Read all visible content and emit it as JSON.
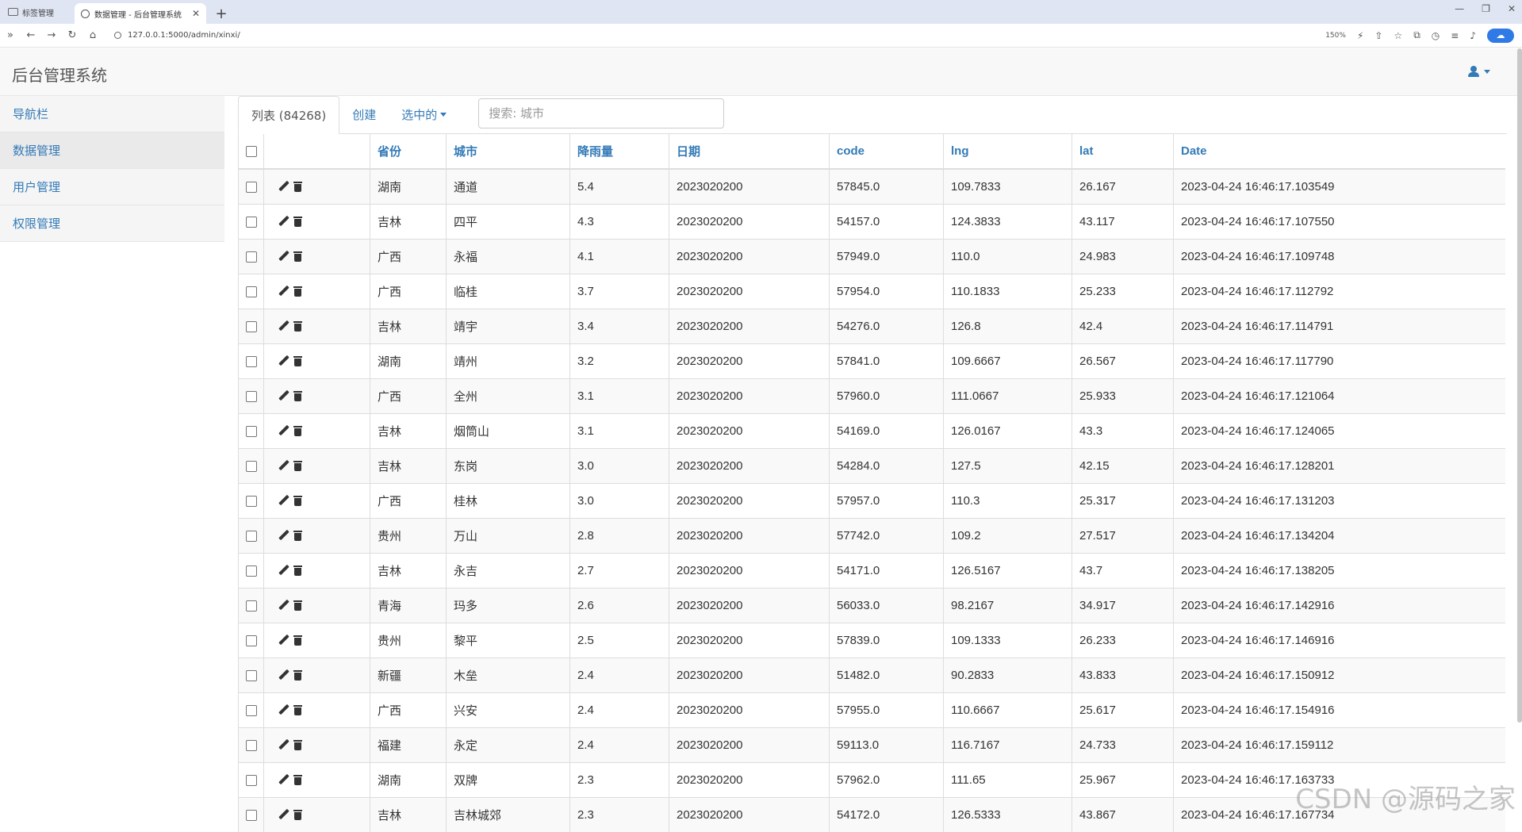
{
  "browser": {
    "tab_group_label": "标签管理",
    "tab_title": "数据管理 - 后台管理系统",
    "tab_close": "✕",
    "new_tab": "+",
    "url": "127.0.0.1:5000/admin/xinxi/",
    "zoom": "150%",
    "win_min": "—",
    "win_max": "❐",
    "win_close": "✕"
  },
  "app": {
    "brand": "后台管理系统",
    "sidebar": [
      {
        "label": "导航栏"
      },
      {
        "label": "数据管理"
      },
      {
        "label": "用户管理"
      },
      {
        "label": "权限管理"
      }
    ],
    "tabs": {
      "list": "列表 (84268)",
      "create": "创建",
      "selected": "选中的"
    },
    "search": {
      "placeholder": "搜索: 城市",
      "value": ""
    },
    "columns": [
      "省份",
      "城市",
      "降雨量",
      "日期",
      "code",
      "lng",
      "lat",
      "Date"
    ],
    "rows": [
      [
        "湖南",
        "通道",
        "5.4",
        "2023020200",
        "57845.0",
        "109.7833",
        "26.167",
        "2023-04-24 16:46:17.103549"
      ],
      [
        "吉林",
        "四平",
        "4.3",
        "2023020200",
        "54157.0",
        "124.3833",
        "43.117",
        "2023-04-24 16:46:17.107550"
      ],
      [
        "广西",
        "永福",
        "4.1",
        "2023020200",
        "57949.0",
        "110.0",
        "24.983",
        "2023-04-24 16:46:17.109748"
      ],
      [
        "广西",
        "临桂",
        "3.7",
        "2023020200",
        "57954.0",
        "110.1833",
        "25.233",
        "2023-04-24 16:46:17.112792"
      ],
      [
        "吉林",
        "靖宇",
        "3.4",
        "2023020200",
        "54276.0",
        "126.8",
        "42.4",
        "2023-04-24 16:46:17.114791"
      ],
      [
        "湖南",
        "靖州",
        "3.2",
        "2023020200",
        "57841.0",
        "109.6667",
        "26.567",
        "2023-04-24 16:46:17.117790"
      ],
      [
        "广西",
        "全州",
        "3.1",
        "2023020200",
        "57960.0",
        "111.0667",
        "25.933",
        "2023-04-24 16:46:17.121064"
      ],
      [
        "吉林",
        "烟筒山",
        "3.1",
        "2023020200",
        "54169.0",
        "126.0167",
        "43.3",
        "2023-04-24 16:46:17.124065"
      ],
      [
        "吉林",
        "东岗",
        "3.0",
        "2023020200",
        "54284.0",
        "127.5",
        "42.15",
        "2023-04-24 16:46:17.128201"
      ],
      [
        "广西",
        "桂林",
        "3.0",
        "2023020200",
        "57957.0",
        "110.3",
        "25.317",
        "2023-04-24 16:46:17.131203"
      ],
      [
        "贵州",
        "万山",
        "2.8",
        "2023020200",
        "57742.0",
        "109.2",
        "27.517",
        "2023-04-24 16:46:17.134204"
      ],
      [
        "吉林",
        "永吉",
        "2.7",
        "2023020200",
        "54171.0",
        "126.5167",
        "43.7",
        "2023-04-24 16:46:17.138205"
      ],
      [
        "青海",
        "玛多",
        "2.6",
        "2023020200",
        "56033.0",
        "98.2167",
        "34.917",
        "2023-04-24 16:46:17.142916"
      ],
      [
        "贵州",
        "黎平",
        "2.5",
        "2023020200",
        "57839.0",
        "109.1333",
        "26.233",
        "2023-04-24 16:46:17.146916"
      ],
      [
        "新疆",
        "木垒",
        "2.4",
        "2023020200",
        "51482.0",
        "90.2833",
        "43.833",
        "2023-04-24 16:46:17.150912"
      ],
      [
        "广西",
        "兴安",
        "2.4",
        "2023020200",
        "57955.0",
        "110.6667",
        "25.617",
        "2023-04-24 16:46:17.154916"
      ],
      [
        "福建",
        "永定",
        "2.4",
        "2023020200",
        "59113.0",
        "116.7167",
        "24.733",
        "2023-04-24 16:46:17.159112"
      ],
      [
        "湖南",
        "双牌",
        "2.3",
        "2023020200",
        "57962.0",
        "111.65",
        "25.967",
        "2023-04-24 16:46:17.163733"
      ],
      [
        "吉林",
        "吉林城郊",
        "2.3",
        "2023020200",
        "54172.0",
        "126.5333",
        "43.867",
        "2023-04-24 16:46:17.167734"
      ]
    ],
    "watermark": "CSDN @源码之家"
  }
}
